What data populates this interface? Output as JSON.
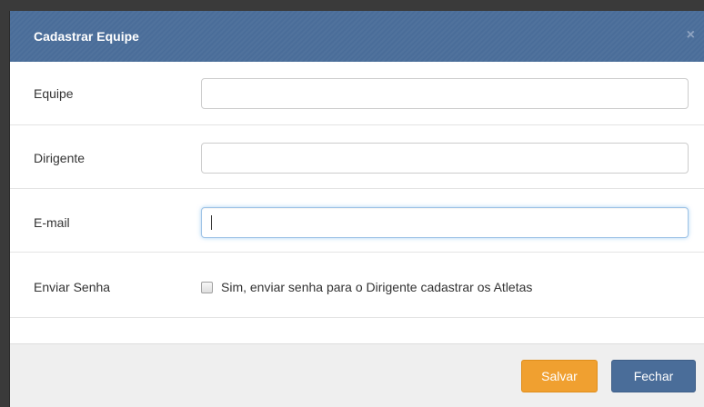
{
  "modal": {
    "title": "Cadastrar Equipe",
    "close_symbol": "×"
  },
  "form": {
    "fields": [
      {
        "label": "Equipe",
        "value": "",
        "placeholder": ""
      },
      {
        "label": "Dirigente",
        "value": "",
        "placeholder": ""
      },
      {
        "label": "E-mail",
        "value": "",
        "placeholder": ""
      }
    ],
    "send_password": {
      "label": "Enviar Senha",
      "checkbox_label": "Sim, enviar senha para o Dirigente cadastrar os Atletas",
      "checked": false
    }
  },
  "footer": {
    "save_label": "Salvar",
    "close_label": "Fechar"
  },
  "colors": {
    "header": "#4a6d99",
    "save_button": "#f0a030",
    "close_button": "#4a6d99"
  },
  "icons": {
    "close": "close-icon"
  }
}
